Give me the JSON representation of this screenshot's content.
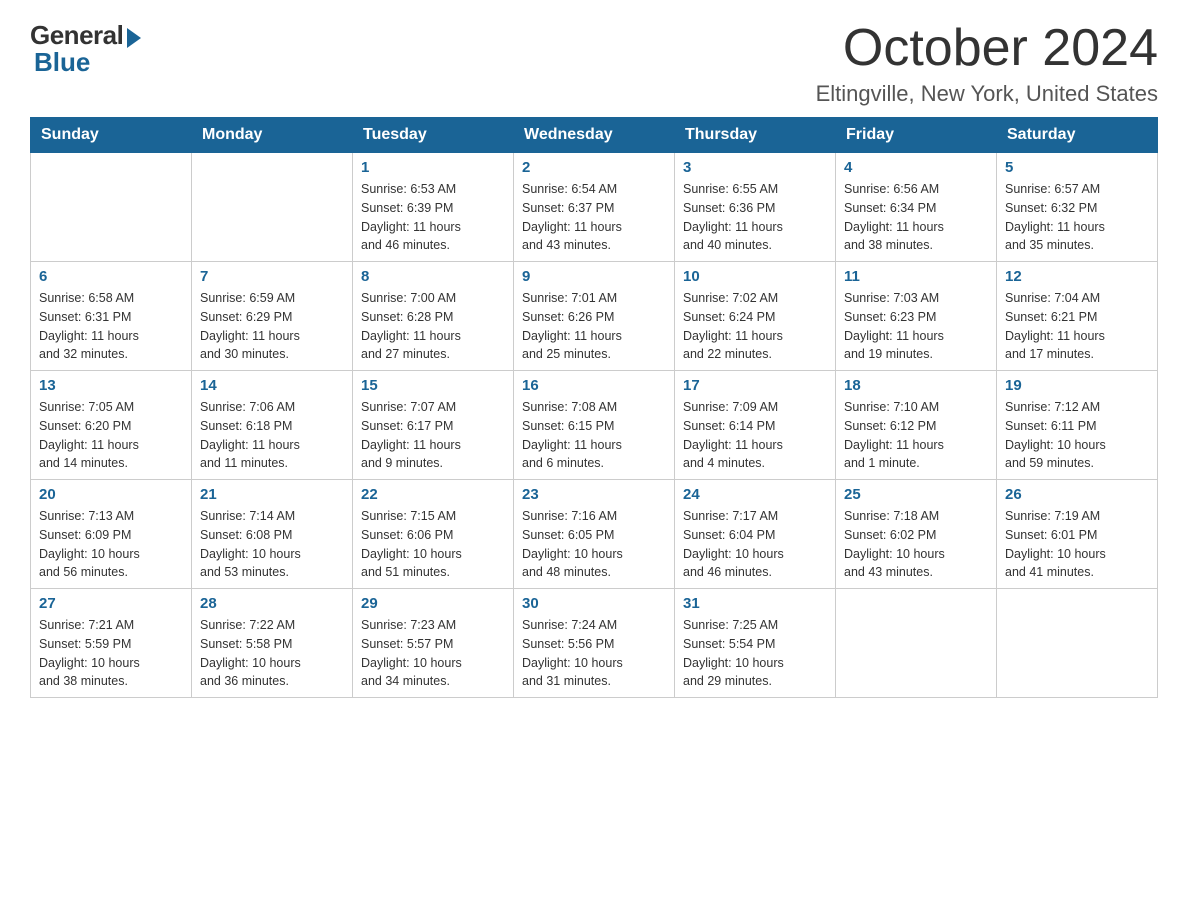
{
  "logo": {
    "general": "General",
    "blue": "Blue"
  },
  "title": "October 2024",
  "subtitle": "Eltingville, New York, United States",
  "days_of_week": [
    "Sunday",
    "Monday",
    "Tuesday",
    "Wednesday",
    "Thursday",
    "Friday",
    "Saturday"
  ],
  "weeks": [
    [
      {
        "day": "",
        "info": ""
      },
      {
        "day": "",
        "info": ""
      },
      {
        "day": "1",
        "info": "Sunrise: 6:53 AM\nSunset: 6:39 PM\nDaylight: 11 hours\nand 46 minutes."
      },
      {
        "day": "2",
        "info": "Sunrise: 6:54 AM\nSunset: 6:37 PM\nDaylight: 11 hours\nand 43 minutes."
      },
      {
        "day": "3",
        "info": "Sunrise: 6:55 AM\nSunset: 6:36 PM\nDaylight: 11 hours\nand 40 minutes."
      },
      {
        "day": "4",
        "info": "Sunrise: 6:56 AM\nSunset: 6:34 PM\nDaylight: 11 hours\nand 38 minutes."
      },
      {
        "day": "5",
        "info": "Sunrise: 6:57 AM\nSunset: 6:32 PM\nDaylight: 11 hours\nand 35 minutes."
      }
    ],
    [
      {
        "day": "6",
        "info": "Sunrise: 6:58 AM\nSunset: 6:31 PM\nDaylight: 11 hours\nand 32 minutes."
      },
      {
        "day": "7",
        "info": "Sunrise: 6:59 AM\nSunset: 6:29 PM\nDaylight: 11 hours\nand 30 minutes."
      },
      {
        "day": "8",
        "info": "Sunrise: 7:00 AM\nSunset: 6:28 PM\nDaylight: 11 hours\nand 27 minutes."
      },
      {
        "day": "9",
        "info": "Sunrise: 7:01 AM\nSunset: 6:26 PM\nDaylight: 11 hours\nand 25 minutes."
      },
      {
        "day": "10",
        "info": "Sunrise: 7:02 AM\nSunset: 6:24 PM\nDaylight: 11 hours\nand 22 minutes."
      },
      {
        "day": "11",
        "info": "Sunrise: 7:03 AM\nSunset: 6:23 PM\nDaylight: 11 hours\nand 19 minutes."
      },
      {
        "day": "12",
        "info": "Sunrise: 7:04 AM\nSunset: 6:21 PM\nDaylight: 11 hours\nand 17 minutes."
      }
    ],
    [
      {
        "day": "13",
        "info": "Sunrise: 7:05 AM\nSunset: 6:20 PM\nDaylight: 11 hours\nand 14 minutes."
      },
      {
        "day": "14",
        "info": "Sunrise: 7:06 AM\nSunset: 6:18 PM\nDaylight: 11 hours\nand 11 minutes."
      },
      {
        "day": "15",
        "info": "Sunrise: 7:07 AM\nSunset: 6:17 PM\nDaylight: 11 hours\nand 9 minutes."
      },
      {
        "day": "16",
        "info": "Sunrise: 7:08 AM\nSunset: 6:15 PM\nDaylight: 11 hours\nand 6 minutes."
      },
      {
        "day": "17",
        "info": "Sunrise: 7:09 AM\nSunset: 6:14 PM\nDaylight: 11 hours\nand 4 minutes."
      },
      {
        "day": "18",
        "info": "Sunrise: 7:10 AM\nSunset: 6:12 PM\nDaylight: 11 hours\nand 1 minute."
      },
      {
        "day": "19",
        "info": "Sunrise: 7:12 AM\nSunset: 6:11 PM\nDaylight: 10 hours\nand 59 minutes."
      }
    ],
    [
      {
        "day": "20",
        "info": "Sunrise: 7:13 AM\nSunset: 6:09 PM\nDaylight: 10 hours\nand 56 minutes."
      },
      {
        "day": "21",
        "info": "Sunrise: 7:14 AM\nSunset: 6:08 PM\nDaylight: 10 hours\nand 53 minutes."
      },
      {
        "day": "22",
        "info": "Sunrise: 7:15 AM\nSunset: 6:06 PM\nDaylight: 10 hours\nand 51 minutes."
      },
      {
        "day": "23",
        "info": "Sunrise: 7:16 AM\nSunset: 6:05 PM\nDaylight: 10 hours\nand 48 minutes."
      },
      {
        "day": "24",
        "info": "Sunrise: 7:17 AM\nSunset: 6:04 PM\nDaylight: 10 hours\nand 46 minutes."
      },
      {
        "day": "25",
        "info": "Sunrise: 7:18 AM\nSunset: 6:02 PM\nDaylight: 10 hours\nand 43 minutes."
      },
      {
        "day": "26",
        "info": "Sunrise: 7:19 AM\nSunset: 6:01 PM\nDaylight: 10 hours\nand 41 minutes."
      }
    ],
    [
      {
        "day": "27",
        "info": "Sunrise: 7:21 AM\nSunset: 5:59 PM\nDaylight: 10 hours\nand 38 minutes."
      },
      {
        "day": "28",
        "info": "Sunrise: 7:22 AM\nSunset: 5:58 PM\nDaylight: 10 hours\nand 36 minutes."
      },
      {
        "day": "29",
        "info": "Sunrise: 7:23 AM\nSunset: 5:57 PM\nDaylight: 10 hours\nand 34 minutes."
      },
      {
        "day": "30",
        "info": "Sunrise: 7:24 AM\nSunset: 5:56 PM\nDaylight: 10 hours\nand 31 minutes."
      },
      {
        "day": "31",
        "info": "Sunrise: 7:25 AM\nSunset: 5:54 PM\nDaylight: 10 hours\nand 29 minutes."
      },
      {
        "day": "",
        "info": ""
      },
      {
        "day": "",
        "info": ""
      }
    ]
  ]
}
